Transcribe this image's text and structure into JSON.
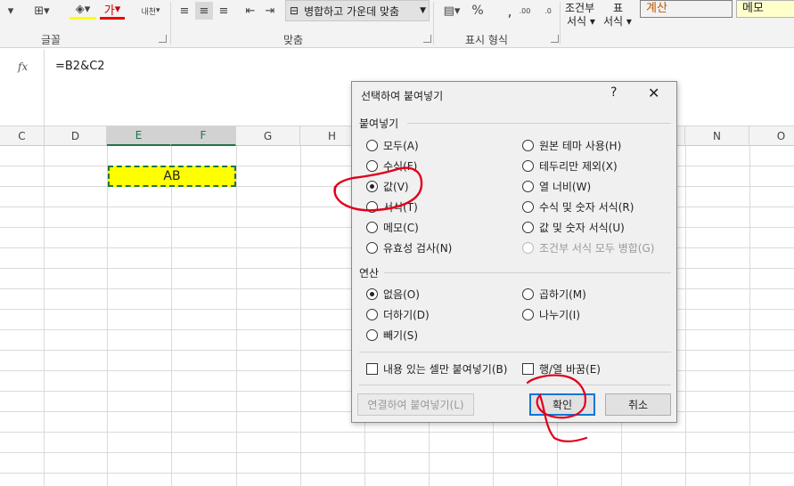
{
  "ribbon": {
    "font_group_label": "글꼴",
    "align_group_label": "맞춤",
    "number_group_label": "표시 형식",
    "merge_label": "병합하고 가운데 맞춤",
    "percent_label": "%",
    "comma_label": ",",
    "conditional_label_1": "조건부",
    "conditional_label_2": "서식",
    "table_label_1": "표",
    "table_label_2": "서식",
    "style_calc": "계산",
    "style_memo": "메모",
    "font_color_glyph": "가",
    "vertical_text_glyph": "내천"
  },
  "formula_bar": {
    "fx_label": "fx",
    "formula": "=B2&C2"
  },
  "columns": [
    "C",
    "D",
    "E",
    "F",
    "G",
    "H",
    "N",
    "O"
  ],
  "cell": {
    "value": "AB",
    "fill": "#ffff00"
  },
  "dialog": {
    "title": "선택하여 붙여넣기",
    "help": "?",
    "close": "✕",
    "paste_section": "붙여넣기",
    "paste_options_left": [
      "모두(A)",
      "수식(F)",
      "값(V)",
      "서식(T)",
      "메모(C)",
      "유효성 검사(N)"
    ],
    "paste_options_right": [
      "원본 테마 사용(H)",
      "테두리만 제외(X)",
      "열 너비(W)",
      "수식 및 숫자 서식(R)",
      "값 및 숫자 서식(U)",
      "조건부 서식 모두 병합(G)"
    ],
    "operation_section": "연산",
    "operation_left": [
      "없음(O)",
      "더하기(D)",
      "빼기(S)"
    ],
    "operation_right": [
      "곱하기(M)",
      "나누기(I)"
    ],
    "skip_blanks": "내용 있는 셀만 붙여넣기(B)",
    "transpose": "행/열 바꿈(E)",
    "paste_link": "연결하여 붙여넣기(L)",
    "ok": "확인",
    "cancel": "취소"
  },
  "colors": {
    "excel_green": "#217346",
    "annotation_red": "#e0001b"
  }
}
